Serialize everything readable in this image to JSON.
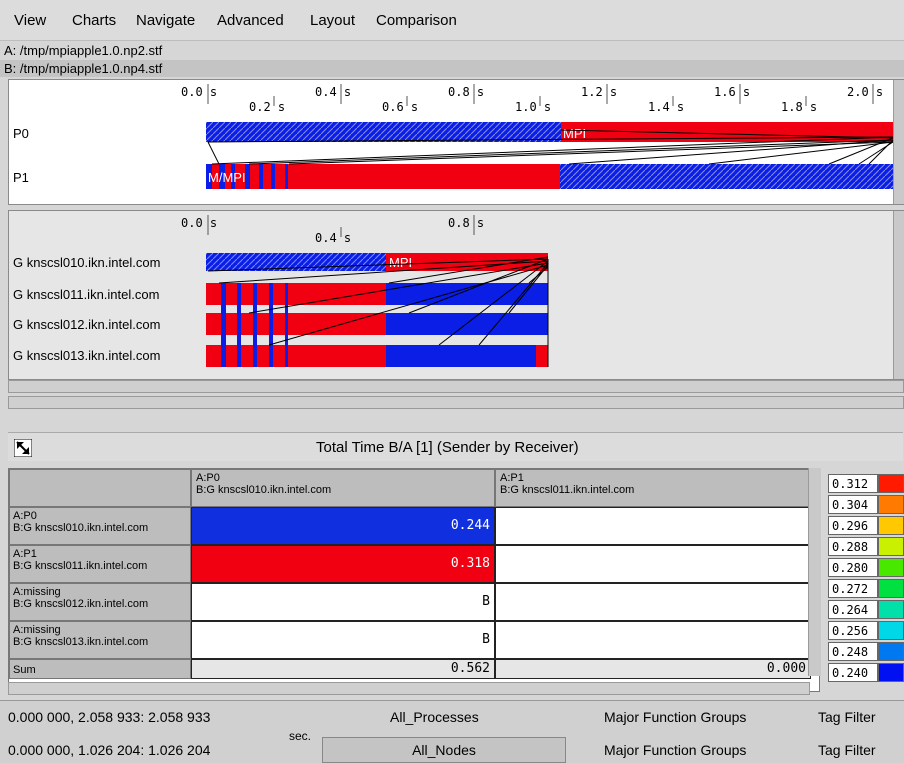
{
  "menu": [
    "View",
    "Charts",
    "Navigate",
    "Advanced",
    "Layout",
    "Comparison"
  ],
  "files": {
    "a": "A: /tmp/mpiapple1.0.np2.stf",
    "b": "B: /tmp/mpiapple1.0.np4.stf"
  },
  "timeline1": {
    "ticks_top": [
      "0.0 s",
      "0.4 s",
      "0.8 s",
      "1.2 s",
      "1.6 s",
      "2.0 s"
    ],
    "ticks_bottom": [
      "0.2 s",
      "0.6 s",
      "1.0 s",
      "1.4 s",
      "1.8 s"
    ],
    "rows": [
      "P0",
      "P1"
    ],
    "mpi_label": "MPI",
    "mpi_label_p1": "M/MPI"
  },
  "timeline2": {
    "ticks_top": [
      "0.0 s",
      "0.8 s"
    ],
    "ticks_bottom": [
      "0.4 s"
    ],
    "rows": [
      "G knscsl010.ikn.intel.com",
      "G knscsl011.ikn.intel.com",
      "G knscsl012.ikn.intel.com",
      "G knscsl013.ikn.intel.com"
    ],
    "mpi_label": "MPI"
  },
  "matrix": {
    "title": "Total Time B/A [1] (Sender by Receiver)",
    "columns": [
      {
        "a": "A:P0",
        "b": "B:G knscsl010.ikn.intel.com"
      },
      {
        "a": "A:P1",
        "b": "B:G knscsl011.ikn.intel.com"
      }
    ],
    "rows": [
      {
        "a": "A:P0",
        "b": "B:G knscsl010.ikn.intel.com",
        "cells": [
          "0.244",
          ""
        ]
      },
      {
        "a": "A:P1",
        "b": "B:G knscsl011.ikn.intel.com",
        "cells": [
          "0.318",
          ""
        ]
      },
      {
        "a": "A:missing",
        "b": "B:G knscsl012.ikn.intel.com",
        "cells": [
          "B",
          ""
        ]
      },
      {
        "a": "A:missing",
        "b": "B:G knscsl013.ikn.intel.com",
        "cells": [
          "B",
          ""
        ]
      }
    ],
    "sum_label": "Sum",
    "sums": [
      "0.562",
      "0.000"
    ],
    "cell_colors": [
      "#1030e0",
      "#f00010"
    ]
  },
  "legend": [
    {
      "value": "0.312",
      "color": "#ff1a00"
    },
    {
      "value": "0.304",
      "color": "#ff7a00"
    },
    {
      "value": "0.296",
      "color": "#ffc800"
    },
    {
      "value": "0.288",
      "color": "#c8f000"
    },
    {
      "value": "0.280",
      "color": "#48e800"
    },
    {
      "value": "0.272",
      "color": "#00e040"
    },
    {
      "value": "0.264",
      "color": "#00e0a8"
    },
    {
      "value": "0.256",
      "color": "#00d8e8"
    },
    {
      "value": "0.248",
      "color": "#0078f0"
    },
    {
      "value": "0.240",
      "color": "#0010f0"
    }
  ],
  "status": {
    "range_a": "0.000 000, 2.058 933: 2.058 933",
    "range_b": "0.000 000, 1.026 204: 1.026 204",
    "unit": "sec.",
    "processes": "All_Processes",
    "nodes": "All_Nodes",
    "group_a": "Major Function Groups",
    "group_b": "Major Function Groups",
    "filter_a": "Tag  Filter",
    "filter_b": "Tag  Filter"
  }
}
